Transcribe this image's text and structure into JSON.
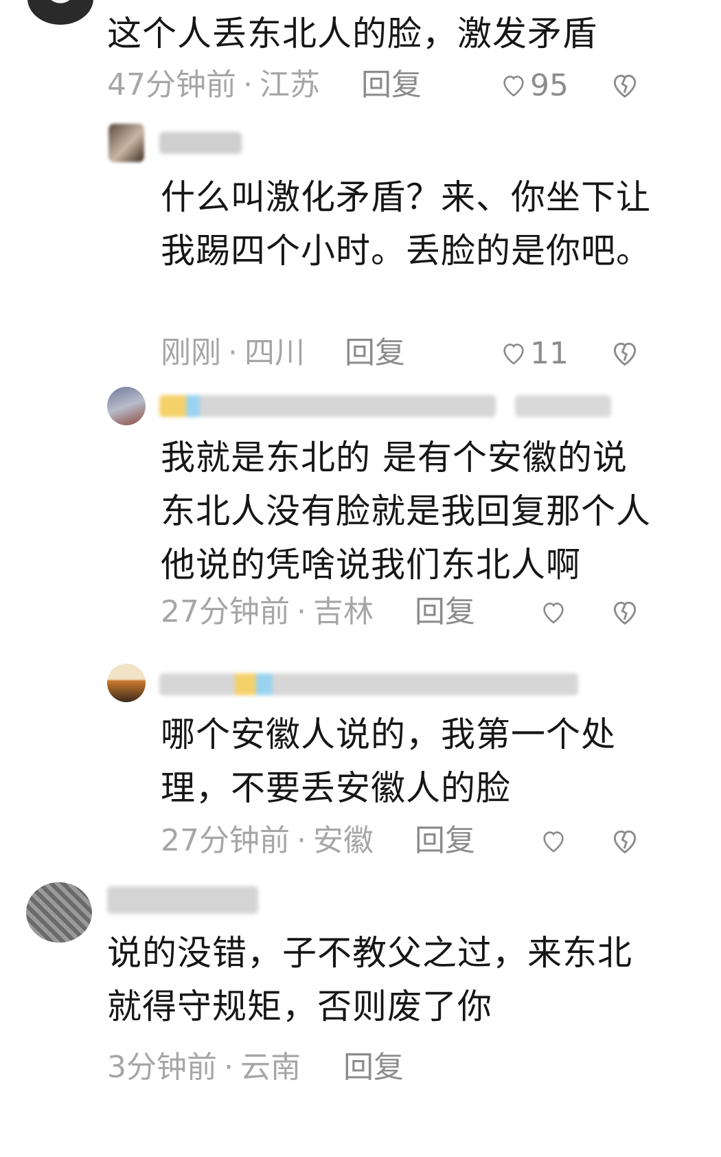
{
  "comments": [
    {
      "text": "这个人丢东北人的脸，激发矛盾",
      "time": "47分钟前",
      "location": "江苏",
      "reply_label": "回复",
      "likes": "95"
    },
    {
      "text": "什么叫激化矛盾？来、你坐下让我踢四个小时。丢脸的是你吧。",
      "time": "刚刚",
      "location": "四川",
      "reply_label": "回复",
      "likes": "11"
    },
    {
      "text": "我就是东北的 是有个安徽的说东北人没有脸就是我回复那个人他说的凭啥说我们东北人啊",
      "time": "27分钟前",
      "location": "吉林",
      "reply_label": "回复",
      "likes": ""
    },
    {
      "text": "哪个安徽人说的，我第一个处理，不要丢安徽人的脸",
      "time": "27分钟前",
      "location": "安徽",
      "reply_label": "回复",
      "likes": ""
    },
    {
      "text": "说的没错，子不教父之过，来东北就得守规矩，否则废了你",
      "time": "3分钟前",
      "location": "云南",
      "reply_label": "回复",
      "likes": ""
    }
  ],
  "separator": "·",
  "icons": {
    "like": "heart-outline-icon",
    "dislike": "broken-heart-icon"
  },
  "colors": {
    "text": "#161616",
    "meta": "#a6a6a6",
    "icon": "#8c8c8c"
  }
}
